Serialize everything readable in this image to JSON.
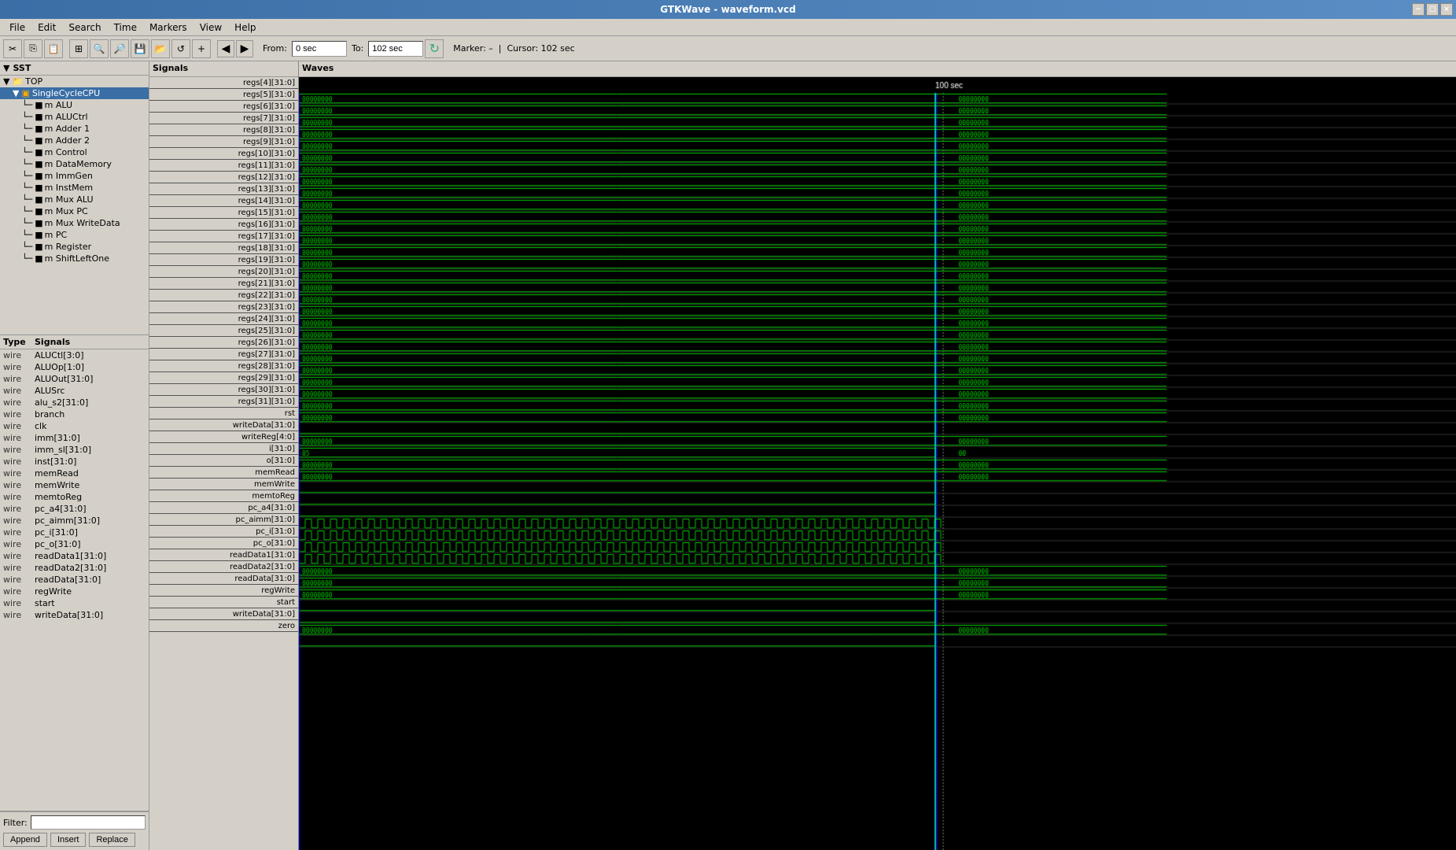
{
  "titlebar": {
    "title": "GTKWave - waveform.vcd",
    "min_label": "−",
    "max_label": "□",
    "close_label": "×"
  },
  "menubar": {
    "items": [
      "File",
      "Edit",
      "Search",
      "Time",
      "Markers",
      "View",
      "Help"
    ]
  },
  "toolbar": {
    "from_label": "From:",
    "from_value": "0 sec",
    "to_label": "To:",
    "to_value": "102 sec",
    "marker_label": "Marker: –",
    "cursor_label": "Cursor: 102 sec"
  },
  "sst": {
    "header": "SST",
    "tree": [
      {
        "indent": 0,
        "icon": "▼",
        "label": "TOP",
        "type": "folder"
      },
      {
        "indent": 1,
        "icon": "▼",
        "label": "SingleCycleCPU",
        "type": "module",
        "selected": true
      },
      {
        "indent": 2,
        "icon": "",
        "label": "m ALU",
        "type": "module"
      },
      {
        "indent": 2,
        "icon": "",
        "label": "m ALUCtrl",
        "type": "module"
      },
      {
        "indent": 2,
        "icon": "",
        "label": "m Adder 1",
        "type": "module"
      },
      {
        "indent": 2,
        "icon": "",
        "label": "m Adder 2",
        "type": "module"
      },
      {
        "indent": 2,
        "icon": "",
        "label": "m Control",
        "type": "module"
      },
      {
        "indent": 2,
        "icon": "",
        "label": "m DataMemory",
        "type": "module"
      },
      {
        "indent": 2,
        "icon": "",
        "label": "m ImmGen",
        "type": "module"
      },
      {
        "indent": 2,
        "icon": "",
        "label": "m InstMem",
        "type": "module"
      },
      {
        "indent": 2,
        "icon": "",
        "label": "m Mux ALU",
        "type": "module"
      },
      {
        "indent": 2,
        "icon": "",
        "label": "m Mux PC",
        "type": "module"
      },
      {
        "indent": 2,
        "icon": "",
        "label": "m Mux WriteData",
        "type": "module"
      },
      {
        "indent": 2,
        "icon": "",
        "label": "m PC",
        "type": "module"
      },
      {
        "indent": 2,
        "icon": "",
        "label": "m Register",
        "type": "module"
      },
      {
        "indent": 2,
        "icon": "",
        "label": "m ShiftLeftOne",
        "type": "module"
      }
    ]
  },
  "signals_panel": {
    "header_type": "Type",
    "header_name": "Signals",
    "items": [
      {
        "type": "wire",
        "name": "ALUCtl[3:0]"
      },
      {
        "type": "wire",
        "name": "ALUOp[1:0]"
      },
      {
        "type": "wire",
        "name": "ALUOut[31:0]"
      },
      {
        "type": "wire",
        "name": "ALUSrc"
      },
      {
        "type": "wire",
        "name": "alu_s2[31:0]"
      },
      {
        "type": "wire",
        "name": "branch"
      },
      {
        "type": "wire",
        "name": "clk"
      },
      {
        "type": "wire",
        "name": "imm[31:0]"
      },
      {
        "type": "wire",
        "name": "imm_sl[31:0]"
      },
      {
        "type": "wire",
        "name": "inst[31:0]"
      },
      {
        "type": "wire",
        "name": "memRead"
      },
      {
        "type": "wire",
        "name": "memWrite"
      },
      {
        "type": "wire",
        "name": "memtoReg"
      },
      {
        "type": "wire",
        "name": "pc_a4[31:0]"
      },
      {
        "type": "wire",
        "name": "pc_aimm[31:0]"
      },
      {
        "type": "wire",
        "name": "pc_i[31:0]"
      },
      {
        "type": "wire",
        "name": "pc_o[31:0]"
      },
      {
        "type": "wire",
        "name": "readData1[31:0]"
      },
      {
        "type": "wire",
        "name": "readData2[31:0]"
      },
      {
        "type": "wire",
        "name": "readData[31:0]"
      },
      {
        "type": "wire",
        "name": "regWrite"
      },
      {
        "type": "wire",
        "name": "start"
      },
      {
        "type": "wire",
        "name": "writeData[31:0]"
      }
    ]
  },
  "filter": {
    "label": "Filter:",
    "placeholder": "",
    "append_label": "Append",
    "insert_label": "Insert",
    "replace_label": "Replace"
  },
  "signals_col": {
    "header": "Signals",
    "entries": [
      "regs[4][31:0]",
      "regs[5][31:0]",
      "regs[6][31:0]",
      "regs[7][31:0]",
      "regs[8][31:0]",
      "regs[9][31:0]",
      "regs[10][31:0]",
      "regs[11][31:0]",
      "regs[12][31:0]",
      "regs[13][31:0]",
      "regs[14][31:0]",
      "regs[15][31:0]",
      "regs[16][31:0]",
      "regs[17][31:0]",
      "regs[18][31:0]",
      "regs[19][31:0]",
      "regs[20][31:0]",
      "regs[21][31:0]",
      "regs[22][31:0]",
      "regs[23][31:0]",
      "regs[24][31:0]",
      "regs[25][31:0]",
      "regs[26][31:0]",
      "regs[27][31:0]",
      "regs[28][31:0]",
      "regs[29][31:0]",
      "regs[30][31:0]",
      "regs[31][31:0]",
      "rst",
      "writeData[31:0]",
      "writeReg[4:0]",
      "i[31:0]",
      "o[31:0]",
      "memRead",
      "memWrite",
      "memtoReg",
      "pc_a4[31:0]",
      "pc_aimm[31:0]",
      "pc_i[31:0]",
      "pc_o[31:0]",
      "readData1[31:0]",
      "readData2[31:0]",
      "readData[31:0]",
      "regWrite",
      "start",
      "writeData[31:0]",
      "zero"
    ]
  },
  "waves": {
    "header": "Waves",
    "time_marker": "100 sec",
    "cursor_pos_pct": 80
  },
  "colors": {
    "wave_green": "#00cc00",
    "wave_blue": "#0088ff",
    "cursor_cyan": "#00ffff",
    "bg_black": "#000000",
    "text_white": "#ffffff"
  }
}
